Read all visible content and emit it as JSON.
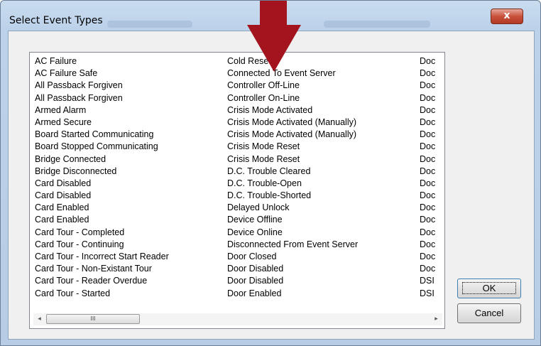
{
  "window": {
    "title": "Select Event Types",
    "close_glyph": "x"
  },
  "list": {
    "column1": [
      "AC Failure",
      "AC Failure Safe",
      "All Passback Forgiven",
      "All Passback Forgiven",
      "Armed Alarm",
      "Armed Secure",
      "Board Started Communicating",
      "Board Stopped Communicating",
      "Bridge Connected",
      "Bridge Disconnected",
      "Card Disabled",
      "Card Disabled",
      "Card Enabled",
      "Card Enabled",
      "Card Tour - Completed",
      "Card Tour - Continuing",
      "Card Tour - Incorrect Start Reader",
      "Card Tour - Non-Existant Tour",
      "Card Tour - Reader Overdue",
      "Card Tour - Started"
    ],
    "column2": [
      "Cold Reset",
      "Connected To Event Server",
      "Controller Off-Line",
      "Controller On-Line",
      "Crisis Mode Activated",
      "Crisis Mode Activated (Manually)",
      "Crisis Mode Activated (Manually)",
      "Crisis Mode Reset",
      "Crisis Mode Reset",
      "D.C. Trouble Cleared",
      "D.C. Trouble-Open",
      "D.C. Trouble-Shorted",
      "Delayed Unlock",
      "Device Offline",
      "Device Online",
      "Disconnected From Event Server",
      "Door Closed",
      "Door Disabled",
      "Door Disabled",
      "Door Enabled"
    ],
    "column3": [
      "Doc",
      "Doc",
      "Doc",
      "Doc",
      "Doc",
      "Doc",
      "Doc",
      "Doc",
      "Doc",
      "Doc",
      "Doc",
      "Doc",
      "Doc",
      "Doc",
      "Doc",
      "Doc",
      "Doc",
      "Doc",
      "DSI",
      "DSI"
    ]
  },
  "scrollbar": {
    "left_arrow": "◂",
    "right_arrow": "▸",
    "thumb_grip": "III"
  },
  "buttons": {
    "ok_label": "OK",
    "cancel_label": "Cancel"
  },
  "colors": {
    "annotation_arrow": "#a3141e",
    "title_bar": "#bcd2ea"
  }
}
